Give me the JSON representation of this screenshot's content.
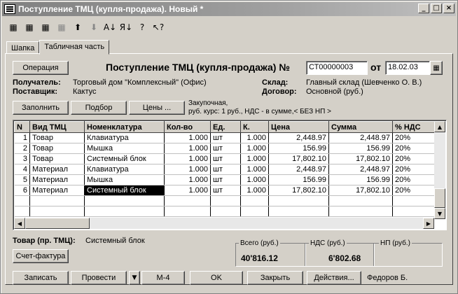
{
  "window": {
    "title": "Поступление ТМЦ (купля-продажа). Новый *",
    "min": "_",
    "max": "□",
    "close": "×"
  },
  "toolbar": {
    "icons": [
      "new-row-icon",
      "add-row-icon",
      "delete-row-icon",
      "copy-row-icon",
      "move-up-icon",
      "move-down-icon",
      "sort-asc-icon",
      "sort-desc-icon",
      "help-icon",
      "context-help-icon"
    ],
    "glyphs": [
      "▦",
      "▦",
      "▦",
      "▦",
      "⬆",
      "⬇",
      "A↓",
      "Я↓",
      "?",
      "↖?"
    ]
  },
  "tabs": [
    {
      "label": "Шапка"
    },
    {
      "label": "Табличная часть"
    }
  ],
  "header": {
    "operation_btn": "Операция",
    "doc_title": "Поступление ТМЦ (купля-продажа) №",
    "doc_number": "СТ00000003",
    "date_label": "от",
    "date": "18.02.03",
    "recipient_label": "Получатель:",
    "recipient": "Торговый дом \"Комплексный\" (Офис)",
    "supplier_label": "Поставщик:",
    "supplier": "Кактус",
    "warehouse_label": "Склад:",
    "warehouse": "Главный склад (Шевченко О. В.)",
    "contract_label": "Договор:",
    "contract": "Основной (руб.)"
  },
  "actions": {
    "fill": "Заполнить",
    "select": "Подбор",
    "prices": "Цены ...",
    "price_info_1": "Закупочная,",
    "price_info_2": "руб. курс: 1 руб., НДС - в сумме,< БЕЗ НП >"
  },
  "table": {
    "columns": [
      "N",
      "Вид ТМЦ",
      "Номенклатура",
      "Кол-во",
      "Ед.",
      "К.",
      "Цена",
      "Сумма",
      "% НДС"
    ],
    "rows": [
      {
        "n": "1",
        "type": "Товар",
        "item": "Клавиатура",
        "qty": "1.000",
        "unit": "шт",
        "k": "1.000",
        "price": "2,448.97",
        "sum": "2,448.97",
        "vat": "20%"
      },
      {
        "n": "2",
        "type": "Товар",
        "item": "Мышка",
        "qty": "1.000",
        "unit": "шт",
        "k": "1.000",
        "price": "156.99",
        "sum": "156.99",
        "vat": "20%"
      },
      {
        "n": "3",
        "type": "Товар",
        "item": "Системный блок",
        "qty": "1.000",
        "unit": "шт",
        "k": "1.000",
        "price": "17,802.10",
        "sum": "17,802.10",
        "vat": "20%"
      },
      {
        "n": "4",
        "type": "Материал",
        "item": "Клавиатура",
        "qty": "1.000",
        "unit": "шт",
        "k": "1.000",
        "price": "2,448.97",
        "sum": "2,448.97",
        "vat": "20%"
      },
      {
        "n": "5",
        "type": "Материал",
        "item": "Мышка",
        "qty": "1.000",
        "unit": "шт",
        "k": "1.000",
        "price": "156.99",
        "sum": "156.99",
        "vat": "20%"
      },
      {
        "n": "6",
        "type": "Материал",
        "item": "Системный блок",
        "qty": "1.000",
        "unit": "шт",
        "k": "1.000",
        "price": "17,802.10",
        "sum": "17,802.10",
        "vat": "20%"
      }
    ],
    "selected_row": 5,
    "selected_col": "item"
  },
  "footer": {
    "goods_label": "Товар (пр. ТМЦ):",
    "goods_value": "Системный блок",
    "invoice_btn": "Счет-фактура",
    "total_label": "Всего (руб.)",
    "total_value": "40'816.12",
    "vat_label": "НДС (руб.)",
    "vat_value": "6'802.68",
    "np_label": "НП (руб.)",
    "np_value": "",
    "btn_save": "Записать",
    "btn_post": "Провести",
    "btn_m4": "М-4",
    "btn_ok": "OK",
    "btn_close": "Закрыть",
    "btn_actions": "Действия...",
    "user": "Федоров Б."
  }
}
